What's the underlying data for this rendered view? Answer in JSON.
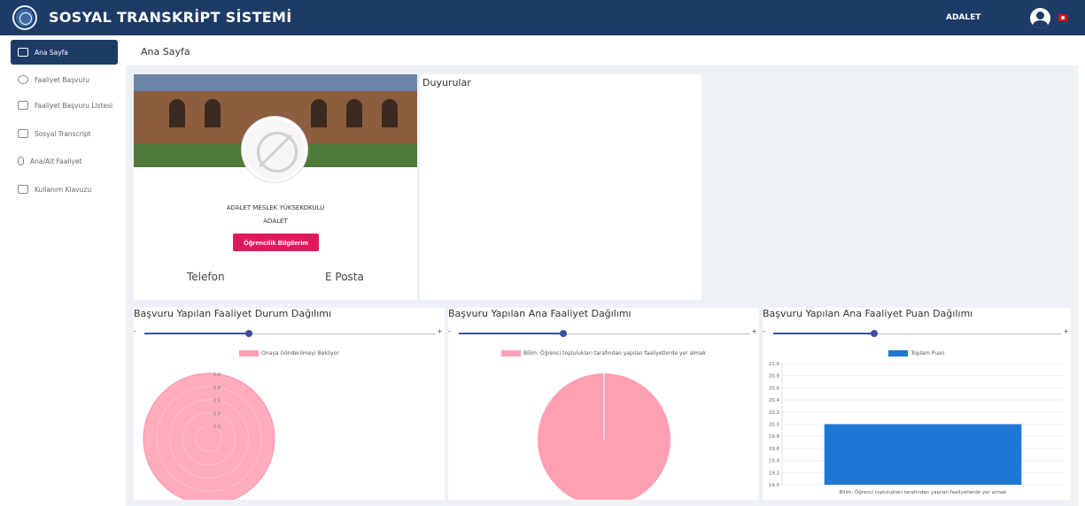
{
  "header": {
    "title": "SOSYAL TRANSKRİPT SİSTEMİ",
    "username": "ADALET"
  },
  "sidebar": {
    "items": [
      {
        "label": "Ana Sayfa",
        "icon": "monitor-icon",
        "active": true
      },
      {
        "label": "Faaliyet Başvuru",
        "icon": "bicycle-icon"
      },
      {
        "label": "Faaliyet Başvuru Listesi",
        "icon": "list-icon"
      },
      {
        "label": "Sosyal Transcript",
        "icon": "graduation-cap-icon"
      },
      {
        "label": "Ana/Alt Faaliyet",
        "icon": "paperclip-icon"
      },
      {
        "label": "Kullanım Klavuzu",
        "icon": "document-icon"
      }
    ]
  },
  "breadcrumb": "Ana Sayfa",
  "profile": {
    "school": "ADALET MESLEK YÜKSEKOKULU",
    "name": "ADALET",
    "button": "Öğrencilik Bilgilerim",
    "phone_label": "Telefon",
    "email_label": "E Posta"
  },
  "announcements": {
    "title": "Duyurular"
  },
  "charts": {
    "c1": {
      "title": "Başvuru Yapılan Faaliyet Durum Dağılımı",
      "slider_value": 0.36
    },
    "c2": {
      "title": "Başvuru Yapılan Ana Faaliyet Dağılımı",
      "slider_value": 0.36
    },
    "c3": {
      "title": "Başvuru Yapılan Ana Faaliyet Puan Dağılımı",
      "slider_value": 0.35
    }
  },
  "slider_minus": "-",
  "slider_plus": "+",
  "colors": {
    "navy": "#1d3b66",
    "pink": "#ff9fb3",
    "blue": "#1f77d4",
    "accent": "#e2185f"
  },
  "chart_data": [
    {
      "type": "polar",
      "title": "Başvuru Yapılan Faaliyet Durum Dağılımı",
      "series": [
        {
          "name": "Onaya Gönderilmeyi Bekliyor",
          "values": [
            1
          ]
        }
      ],
      "r_ticks": [
        "1.0",
        "0.8",
        "0.6",
        "0.4",
        "0.2"
      ],
      "color": "#ff9fb3"
    },
    {
      "type": "pie",
      "title": "Başvuru Yapılan Ana Faaliyet Dağılımı",
      "categories": [
        "Bilim: Öğrenci toplulukları tarafından yapılan faaliyetlerde yer almak"
      ],
      "values": [
        1
      ],
      "color": "#ff9fb3"
    },
    {
      "type": "bar",
      "title": "Başvuru Yapılan Ana Faaliyet Puan Dağılımı",
      "categories": [
        "Bilim: Öğrenci toplulukları tarafından yapılan faaliyetlerde yer almak"
      ],
      "series": [
        {
          "name": "Toplam Puan",
          "values": [
            20
          ]
        }
      ],
      "ylim": [
        19,
        21
      ],
      "yticks": [
        "21.0",
        "20.8",
        "20.6",
        "20.4",
        "20.2",
        "20.0",
        "19.8",
        "19.6",
        "19.4",
        "19.2",
        "19.0"
      ],
      "color": "#1f77d4"
    }
  ]
}
